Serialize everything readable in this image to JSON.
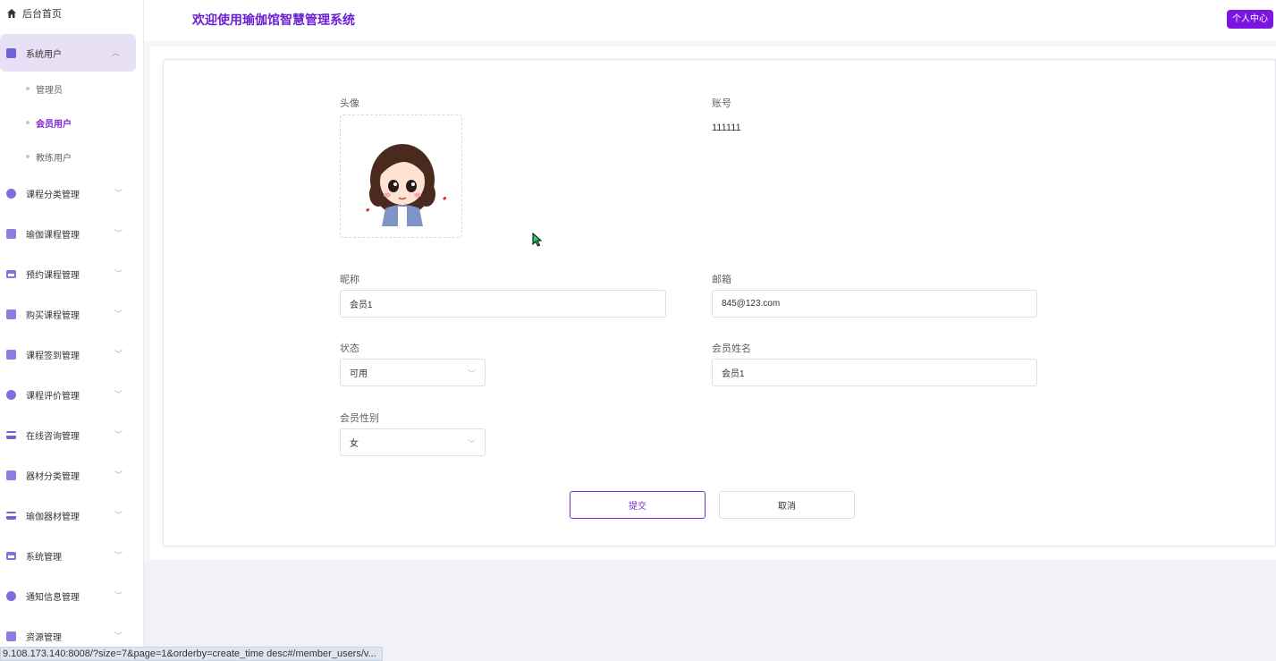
{
  "sidebar": {
    "home_label": "后台首页",
    "group_label": "系统用户",
    "sub_items": [
      {
        "label": "管理员"
      },
      {
        "label": "会员用户"
      },
      {
        "label": "教练用户"
      }
    ],
    "items": [
      {
        "label": "课程分类管理",
        "icon": "round-icon"
      },
      {
        "label": "瑜伽课程管理",
        "icon": "db-icon"
      },
      {
        "label": "预约课程管理",
        "icon": "tray-icon"
      },
      {
        "label": "购买课程管理",
        "icon": "doc-icon"
      },
      {
        "label": "课程签到管理",
        "icon": "doc-icon"
      },
      {
        "label": "课程评价管理",
        "icon": "round-icon"
      },
      {
        "label": "在线咨询管理",
        "icon": "list-icon"
      },
      {
        "label": "器材分类管理",
        "icon": "db-icon"
      },
      {
        "label": "瑜伽器材管理",
        "icon": "list-icon"
      },
      {
        "label": "系统管理",
        "icon": "tray-icon"
      },
      {
        "label": "通知信息管理",
        "icon": "round-icon"
      },
      {
        "label": "资源管理",
        "icon": "doc-icon"
      }
    ]
  },
  "header": {
    "title": "欢迎使用瑜伽馆智慧管理系统",
    "personal_center": "个人中心"
  },
  "form": {
    "avatar_label": "头像",
    "account_label": "账号",
    "account_value": "111111",
    "nickname_label": "昵称",
    "nickname_value": "会员1",
    "email_label": "邮箱",
    "email_value": "845@123.com",
    "status_label": "状态",
    "status_value": "可用",
    "name_label": "会员姓名",
    "name_value": "会员1",
    "gender_label": "会员性别",
    "gender_value": "女",
    "submit_label": "提交",
    "cancel_label": "取消"
  },
  "statusbar": {
    "url": "9.108.173.140:8008/?size=7&page=1&orderby=create_time desc#/member_users/v..."
  },
  "colors": {
    "accent": "#7b16e0",
    "title": "#6b1fd1",
    "active_group_bg": "#e8e1f5"
  }
}
